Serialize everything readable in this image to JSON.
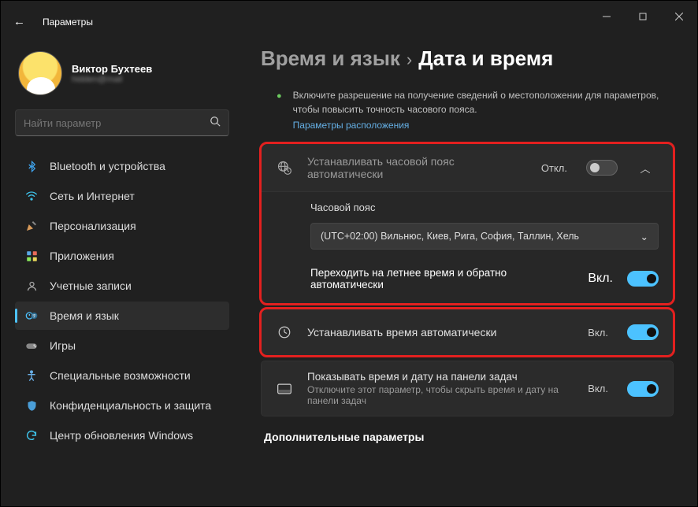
{
  "app": {
    "title": "Параметры"
  },
  "user": {
    "name": "Виктор Бухтеев",
    "email": "hidden@mail"
  },
  "search": {
    "placeholder": "Найти параметр"
  },
  "nav": [
    {
      "icon": "bt",
      "label": "Bluetooth и устройства"
    },
    {
      "icon": "wifi",
      "label": "Сеть и Интернет"
    },
    {
      "icon": "pers",
      "label": "Персонализация"
    },
    {
      "icon": "apps",
      "label": "Приложения"
    },
    {
      "icon": "acct",
      "label": "Учетные записи"
    },
    {
      "icon": "time",
      "label": "Время и язык"
    },
    {
      "icon": "game",
      "label": "Игры"
    },
    {
      "icon": "acc",
      "label": "Специальные возможности"
    },
    {
      "icon": "sec",
      "label": "Конфиденциальность и защита"
    },
    {
      "icon": "upd",
      "label": "Центр обновления Windows"
    }
  ],
  "breadcrumb": {
    "level1": "Время и язык",
    "sep": "›",
    "level2": "Дата и время"
  },
  "info": {
    "text": "Включите разрешение на получение сведений о местоположении для параметров, чтобы повысить точность часового пояса.",
    "link": "Параметры расположения"
  },
  "rows": {
    "autoTimezone": {
      "label": "Устанавливать часовой пояс автоматически",
      "state": "Откл.",
      "on": false
    },
    "timezoneHead": "Часовой пояс",
    "timezoneValue": "(UTC+02:00) Вильнюс, Киев, Рига, София, Таллин, Хель",
    "dst": {
      "label": "Переходить на летнее время и обратно автоматически",
      "state": "Вкл.",
      "on": true
    },
    "autoTime": {
      "label": "Устанавливать время автоматически",
      "state": "Вкл.",
      "on": true
    },
    "taskbar": {
      "label": "Показывать время и дату на панели задач",
      "sub": "Отключите этот параметр, чтобы скрыть время и дату на панели задач",
      "state": "Вкл.",
      "on": true
    }
  },
  "additional": "Дополнительные параметры"
}
